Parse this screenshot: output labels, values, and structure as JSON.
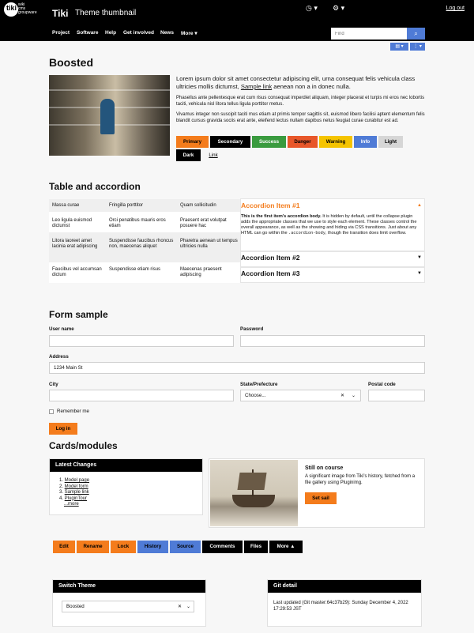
{
  "header": {
    "logo_text": "tiki",
    "logo_sub": [
      "wiki",
      "cms",
      "groupware"
    ],
    "brand": "Tiki",
    "site_title": "Theme thumbnail",
    "logout": "Log out"
  },
  "nav": {
    "items": [
      "Project",
      "Software",
      "Help",
      "Get involved",
      "News",
      "More"
    ],
    "search_placeholder": "Find"
  },
  "boosted": {
    "title": "Boosted",
    "lead_before_link": "Lorem ipsum dolor sit amet consectetur adipiscing elit, urna consequat felis vehicula class ultricies mollis dictumst,",
    "lead_link": "Sample link",
    "lead_after_link": "aenean non a in donec nulla.",
    "para1": "Phasellus ante pellentesque erat cum risus consequat imperdiet aliquam, integer placerat et turpis mi eros nec lobortis taciti, vehicula nisl litora tellus ligula porttitor metus.",
    "para2": "Vivamus integer non suscipit taciti mus etiam at primis tempor sagittis sit, euismod libero facilisi aptent elementum felis blandit cursus gravida sociis erat ante, eleifend lectus nullam dapibus netus feugiat curae curabitur est ad.",
    "buttons": [
      "Primary",
      "Secondary",
      "Success",
      "Danger",
      "Warning",
      "Info",
      "Light",
      "Dark",
      "Link"
    ]
  },
  "table_accordion": {
    "title": "Table and accordion",
    "table": [
      [
        "Massa curae",
        "Fringilla porttitor",
        "Quam sollicitudin"
      ],
      [
        "Leo ligula euismod dictumst",
        "Orci penatibus mauris eros etiam",
        "Praesent erat volutpat posuere hac"
      ],
      [
        "Litora laoreet amet lacinia erat adipiscing",
        "Suspendisse faucibus rhoncus non, maecenas aliquet",
        "Pharetra aenean ut tempus ultricies nulla"
      ],
      [
        "Faucibus vel accumsan dictum",
        "Suspendisse etiam risus",
        "Maecenas praesent adipiscing"
      ]
    ],
    "accordion": [
      {
        "title": "Accordion Item #1",
        "body_strong": "This is the first item's accordion body.",
        "body": "It is hidden by default, until the collapse plugin adds the appropriate classes that we use to style each element. These classes control the overall appearance, as well as the showing and hiding via CSS transitions. Just about any HTML can go within the",
        "body_code": ".accordion-body",
        "body_end": ", though the transition does limit overflow."
      },
      {
        "title": "Accordion Item #2"
      },
      {
        "title": "Accordion Item #3"
      }
    ]
  },
  "form": {
    "title": "Form sample",
    "username_label": "User name",
    "password_label": "Password",
    "address_label": "Address",
    "address_value": "1234 Main St",
    "city_label": "City",
    "state_label": "State/Prefecture",
    "state_value": "Choose...",
    "postal_label": "Postal code",
    "remember_label": "Remember me",
    "login_label": "Log in"
  },
  "cards": {
    "title": "Cards/modules",
    "latest_title": "Latest Changes",
    "latest_items": [
      "Model page",
      "Model form",
      "Sample link",
      "PluginTour"
    ],
    "latest_more": "...more",
    "still_title": "Still on course",
    "still_text": "A significant image from Tiki's history, fetched from a file gallery using Pluginimg.",
    "set_sail": "Set sail"
  },
  "actions": [
    "Edit",
    "Rename",
    "Lock",
    "History",
    "Source",
    "Comments",
    "Files",
    "More"
  ],
  "switch_theme": {
    "title": "Switch Theme",
    "value": "Boosted"
  },
  "git": {
    "title": "Git detail",
    "text": "Last updated (Git master:64c37b29): Sunday December 4, 2022 17:29:53 JST"
  },
  "colors": {
    "primary": "#f47c1c",
    "secondary": "#000000",
    "success": "#3a9b3f",
    "danger": "#e8572a",
    "warning": "#f5c400",
    "info": "#4f7bd6",
    "light": "#d6d6d6",
    "dark": "#000000"
  }
}
